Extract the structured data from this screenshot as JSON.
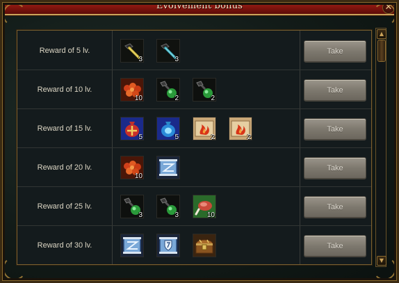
{
  "window": {
    "title": "Evolvement bonus",
    "close_glyph": "✕"
  },
  "colors": {
    "title_bar": "#8c1a10",
    "gold_border": "#caa35a",
    "button": "#8a857b"
  },
  "rows": [
    {
      "label": "Reward of 5 lv.",
      "button": "Take",
      "items": [
        {
          "icon": "pickaxe-yellow-icon",
          "count": "3"
        },
        {
          "icon": "pickaxe-cyan-icon",
          "count": "3"
        }
      ]
    },
    {
      "label": "Reward of 10 lv.",
      "button": "Take",
      "items": [
        {
          "icon": "red-ore-pile-icon",
          "count": "10"
        },
        {
          "icon": "green-potion-icon",
          "count": "2"
        },
        {
          "icon": "green-potion-icon",
          "count": "2"
        }
      ]
    },
    {
      "label": "Reward of 15 lv.",
      "button": "Take",
      "items": [
        {
          "icon": "red-pouch-icon",
          "count": "5"
        },
        {
          "icon": "blue-pouch-icon",
          "count": "5"
        },
        {
          "icon": "fire-scroll-icon",
          "count": "2"
        },
        {
          "icon": "fire-scroll-icon",
          "count": "2"
        }
      ]
    },
    {
      "label": "Reward of 20 lv.",
      "button": "Take",
      "items": [
        {
          "icon": "red-ore-pile-icon",
          "count": "10"
        },
        {
          "icon": "blue-scroll-icon",
          "count": ""
        }
      ]
    },
    {
      "label": "Reward of 25 lv.",
      "button": "Take",
      "items": [
        {
          "icon": "green-potion-icon",
          "count": "3"
        },
        {
          "icon": "green-potion-icon",
          "count": "3"
        },
        {
          "icon": "meat-icon",
          "count": "10"
        }
      ]
    },
    {
      "label": "Reward of 30 lv.",
      "button": "Take",
      "items": [
        {
          "icon": "blue-scroll-icon",
          "count": ""
        },
        {
          "icon": "shield-scroll-icon",
          "count": ""
        },
        {
          "icon": "treasure-chest-icon",
          "count": ""
        }
      ]
    }
  ],
  "scrollbar": {
    "up_glyph": "▲",
    "down_glyph": "▼"
  }
}
